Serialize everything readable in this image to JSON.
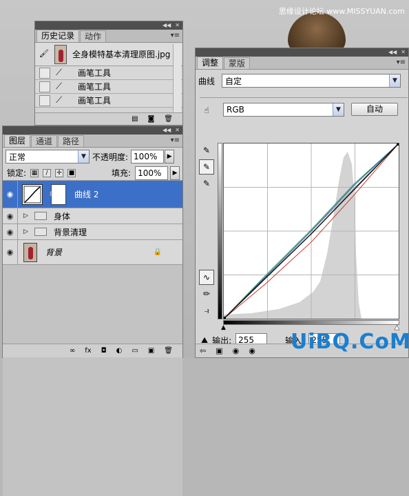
{
  "watermark": "思缘设计论坛 www.MISSYUAN.com",
  "brand": "UiBQ.CoM",
  "history": {
    "tabs": [
      "历史记录",
      "动作"
    ],
    "snapshot_name": "全身模特基本清理原图.jpg",
    "steps": [
      "画笔工具",
      "画笔工具",
      "画笔工具"
    ]
  },
  "layers": {
    "tabs": [
      "图层",
      "通道",
      "路径"
    ],
    "blend_mode": "正常",
    "opacity_label": "不透明度:",
    "opacity": "100%",
    "lock_label": "锁定:",
    "fill_label": "填充:",
    "fill": "100%",
    "items": [
      {
        "name": "曲线 2"
      },
      {
        "name": "身体"
      },
      {
        "name": "背景清理"
      },
      {
        "name": "背景"
      }
    ]
  },
  "adjustments": {
    "tabs": [
      "调整",
      "蒙版"
    ],
    "type_label": "曲线",
    "preset": "自定",
    "channel": "RGB",
    "auto_button": "自动",
    "output_label": "输出:",
    "output_value": "255",
    "input_label": "输入:",
    "input_value": "255"
  },
  "chart_data": {
    "type": "line",
    "xlim": [
      0,
      255
    ],
    "ylim": [
      0,
      255
    ],
    "series": [
      {
        "color": "#c0392b",
        "x": [
          0,
          60,
          128,
          190,
          255
        ],
        "y": [
          0,
          50,
          112,
          180,
          255
        ]
      },
      {
        "color": "#2f8f5a",
        "x": [
          0,
          60,
          128,
          190,
          255
        ],
        "y": [
          0,
          62,
          130,
          196,
          255
        ]
      },
      {
        "color": "#2a5db0",
        "x": [
          0,
          60,
          128,
          190,
          255
        ],
        "y": [
          0,
          60,
          128,
          194,
          255
        ]
      },
      {
        "color": "#111111",
        "x": [
          0,
          128,
          255
        ],
        "y": [
          0,
          124,
          255
        ]
      }
    ]
  }
}
